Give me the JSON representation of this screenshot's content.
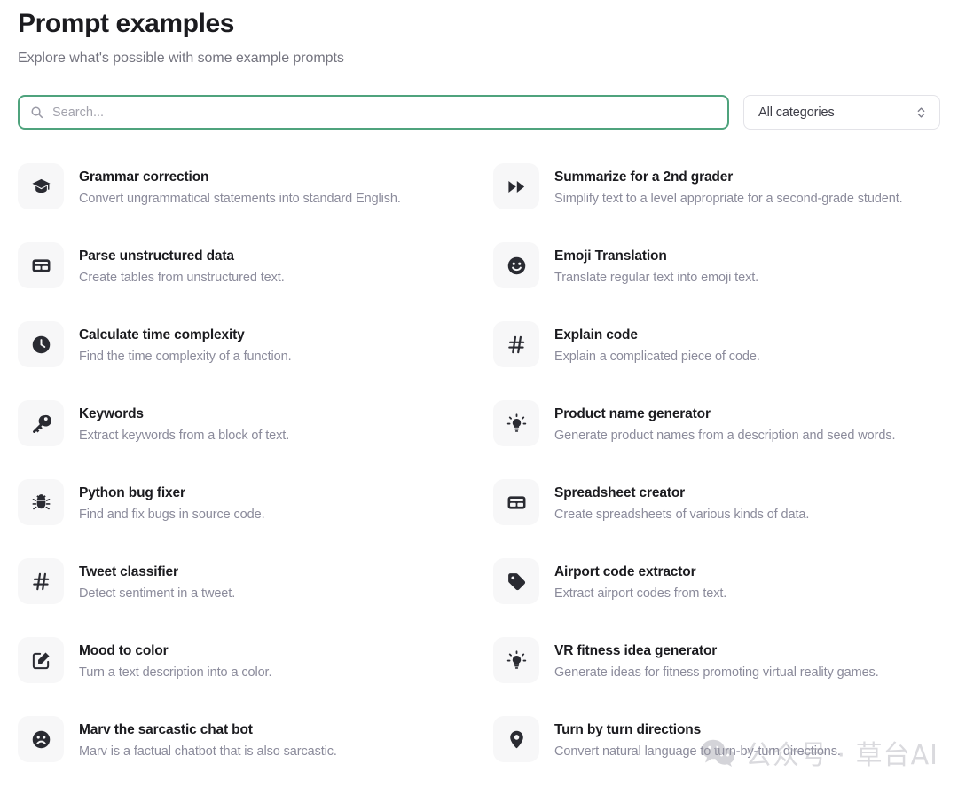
{
  "header": {
    "title": "Prompt examples",
    "subtitle": "Explore what's possible with some example prompts"
  },
  "search": {
    "placeholder": "Search...",
    "value": "",
    "icon": "search-icon",
    "focused": true,
    "focus_border_color": "#4fa37d"
  },
  "category_filter": {
    "selected": "All categories",
    "icon": "chevron-updown-icon",
    "options": [
      "All categories"
    ]
  },
  "watermark": {
    "text": "公众号 · 草台AI",
    "icon": "wechat-icon",
    "color": "#a8a8b2"
  },
  "colors": {
    "accent_green": "#4fa37d",
    "title": "#1b1b1f",
    "subtitle": "#74747f",
    "card_title": "#1b1b1f",
    "card_desc": "#8b8b9b",
    "icon_tile_bg": "#f7f7f8",
    "icon_glyph": "#2a2b32",
    "border": "#e3e3e8",
    "page_bg": "#ffffff"
  },
  "cards": [
    {
      "title": "Grammar correction",
      "desc": "Convert ungrammatical statements into standard English.",
      "icon": "graduation-cap-icon",
      "column": "left"
    },
    {
      "title": "Summarize for a 2nd grader",
      "desc": "Simplify text to a level appropriate for a second-grade student.",
      "icon": "fast-forward-icon",
      "column": "right"
    },
    {
      "title": "Parse unstructured data",
      "desc": "Create tables from unstructured text.",
      "icon": "table-icon",
      "column": "left"
    },
    {
      "title": "Emoji Translation",
      "desc": "Translate regular text into emoji text.",
      "icon": "smiley-face-icon",
      "column": "right"
    },
    {
      "title": "Calculate time complexity",
      "desc": "Find the time complexity of a function.",
      "icon": "clock-icon",
      "column": "left"
    },
    {
      "title": "Explain code",
      "desc": "Explain a complicated piece of code.",
      "icon": "hash-icon",
      "column": "right"
    },
    {
      "title": "Keywords",
      "desc": "Extract keywords from a block of text.",
      "icon": "key-icon",
      "column": "left"
    },
    {
      "title": "Product name generator",
      "desc": "Generate product names from a description and seed words.",
      "icon": "lightbulb-icon",
      "column": "right"
    },
    {
      "title": "Python bug fixer",
      "desc": "Find and fix bugs in source code.",
      "icon": "bug-icon",
      "column": "left"
    },
    {
      "title": "Spreadsheet creator",
      "desc": "Create spreadsheets of various kinds of data.",
      "icon": "table-icon",
      "column": "right"
    },
    {
      "title": "Tweet classifier",
      "desc": "Detect sentiment in a tweet.",
      "icon": "hash-icon",
      "column": "left"
    },
    {
      "title": "Airport code extractor",
      "desc": "Extract airport codes from text.",
      "icon": "tag-icon",
      "column": "right"
    },
    {
      "title": "Mood to color",
      "desc": "Turn a text description into a color.",
      "icon": "edit-square-icon",
      "column": "left"
    },
    {
      "title": "VR fitness idea generator",
      "desc": "Generate ideas for fitness promoting virtual reality games.",
      "icon": "lightbulb-icon",
      "column": "right"
    },
    {
      "title": "Marv the sarcastic chat bot",
      "desc": "Marv is a factual chatbot that is also sarcastic.",
      "icon": "frowning-face-icon",
      "column": "left"
    },
    {
      "title": "Turn by turn directions",
      "desc": "Convert natural language to turn-by-turn directions.",
      "icon": "location-pin-icon",
      "column": "right"
    }
  ]
}
